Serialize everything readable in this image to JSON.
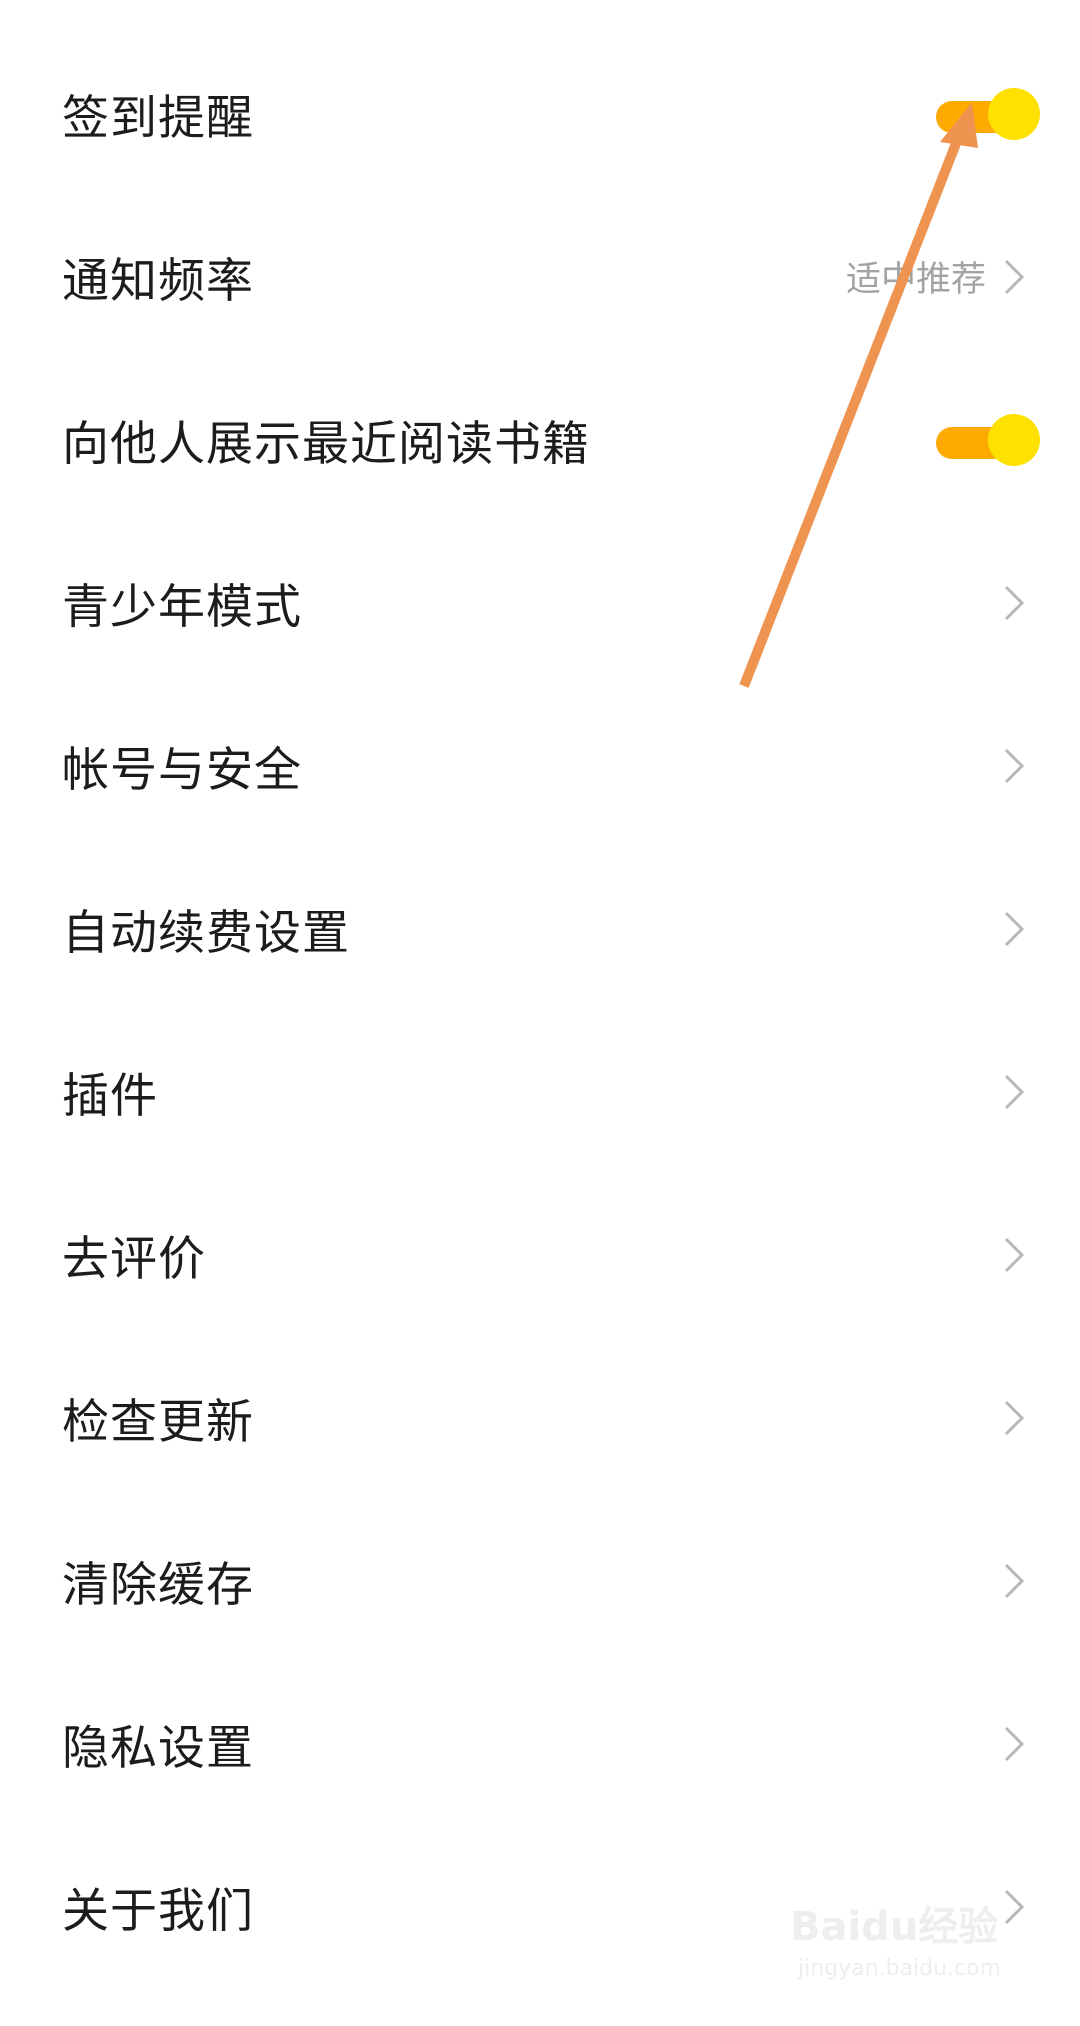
{
  "settings": {
    "items": [
      {
        "label": "签到提醒",
        "control": "toggle",
        "on": true
      },
      {
        "label": "通知频率",
        "control": "chevron",
        "value": "适中推荐"
      },
      {
        "label": "向他人展示最近阅读书籍",
        "control": "toggle",
        "on": true
      },
      {
        "label": "青少年模式",
        "control": "chevron"
      },
      {
        "label": "帐号与安全",
        "control": "chevron"
      },
      {
        "label": "自动续费设置",
        "control": "chevron"
      },
      {
        "label": "插件",
        "control": "chevron"
      },
      {
        "label": "去评价",
        "control": "chevron"
      },
      {
        "label": "检查更新",
        "control": "chevron"
      },
      {
        "label": "清除缓存",
        "control": "chevron"
      },
      {
        "label": "隐私设置",
        "control": "chevron"
      },
      {
        "label": "关于我们",
        "control": "chevron"
      }
    ]
  },
  "colors": {
    "toggle_track": "#ffaa00",
    "toggle_knob": "#ffe100",
    "annotation_arrow": "#ef9350",
    "chevron": "#b8b8b8",
    "value_text": "#a3a3a3"
  },
  "watermark": {
    "brand": "Baidu经验",
    "url": "jingyan.baidu.com"
  }
}
